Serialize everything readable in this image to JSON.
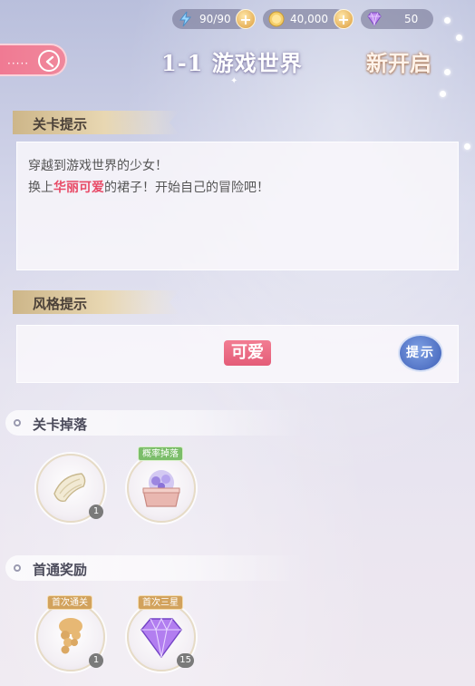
{
  "resources": {
    "stamina": "90/90",
    "coins": "40,000",
    "gems": "50",
    "stamina_icon": "lightning-icon",
    "coin_icon": "gold-coin-icon",
    "gem_icon": "purple-diamond-icon"
  },
  "header": {
    "back_dots": "·····",
    "title": "1-1 游戏世界",
    "new_open": "新开启"
  },
  "stage_hint": {
    "label": "关卡提示",
    "line1": "穿越到游戏世界的少女！",
    "line2_prefix": "换上",
    "line2_highlight": "华丽可爱",
    "line2_suffix": "的裙子！开始自己的冒险吧！"
  },
  "style_hint": {
    "label": "风格提示",
    "tag": "可爱",
    "button": "提示"
  },
  "stage_drops": {
    "label": "关卡掉落",
    "items": [
      {
        "icon": "cloth-roll-icon",
        "count": "1"
      },
      {
        "icon": "gem-chest-icon",
        "tag": "概率掉落"
      }
    ]
  },
  "first_clear": {
    "label": "首通奖励",
    "items": [
      {
        "icon": "curly-wig-icon",
        "tag": "首次通关",
        "count": "1"
      },
      {
        "icon": "purple-diamond-icon",
        "tag": "首次三星",
        "count": "15"
      }
    ]
  },
  "colors": {
    "accent_pink": "#e84a66",
    "button_blue": "#4e6fc2",
    "ribbon_gold": "#d8c397"
  }
}
